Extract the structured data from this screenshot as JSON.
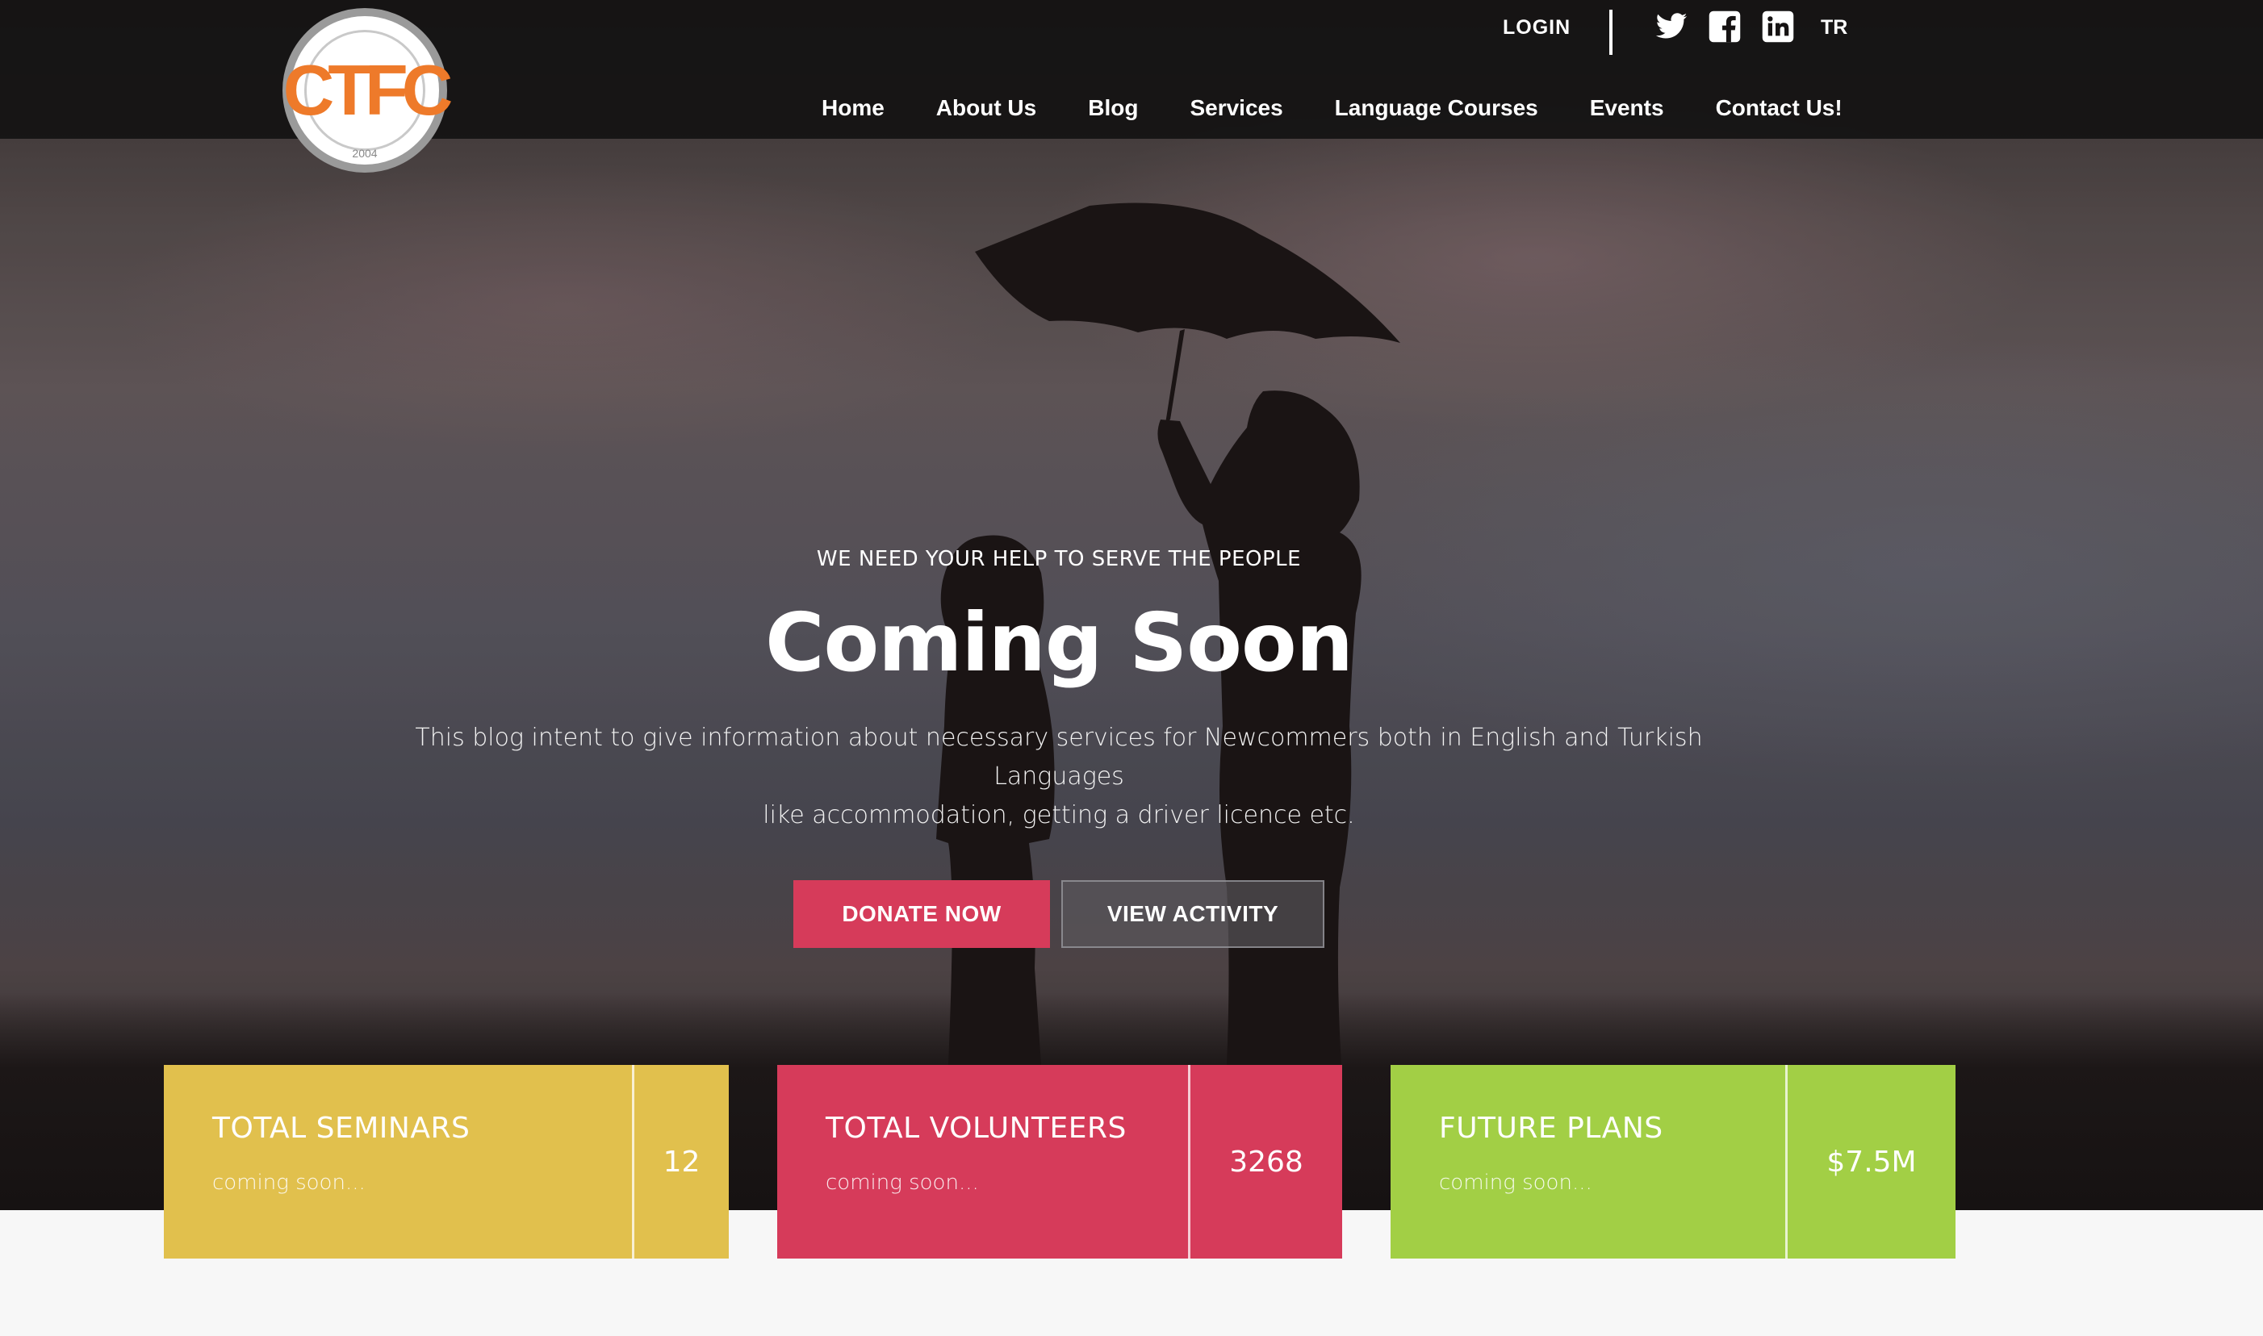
{
  "site": {
    "logo_alt": "Canadian Turkish Friendship Community",
    "logo_mark": "CTFC",
    "logo_year": "2004"
  },
  "topbar": {
    "login": "LOGIN",
    "lang": "TR",
    "social": [
      {
        "icon": "twitter-icon"
      },
      {
        "icon": "facebook-icon"
      },
      {
        "icon": "linkedin-icon"
      }
    ]
  },
  "nav": {
    "items": [
      {
        "label": "Home"
      },
      {
        "label": "About Us"
      },
      {
        "label": "Blog"
      },
      {
        "label": "Services"
      },
      {
        "label": "Language Courses"
      },
      {
        "label": "Events"
      },
      {
        "label": "Contact Us!"
      }
    ]
  },
  "hero": {
    "eyebrow": "WE NEED YOUR HELP TO SERVE THE PEOPLE",
    "headline": "Coming Soon",
    "description_line1": "This blog intent to give information about necessary services for Newcommers both in English and Turkish Languages",
    "description_line2": "like accommodation, getting a driver licence etc.",
    "donate_label": "DONATE NOW",
    "view_label": "VIEW ACTIVITY"
  },
  "stats": [
    {
      "title": "TOTAL SEMINARS",
      "sub": "coming soon...",
      "value": "12",
      "color": "#e1c04d"
    },
    {
      "title": "TOTAL VOLUNTEERS",
      "sub": "coming soon...",
      "value": "3268",
      "color": "#d63b5a"
    },
    {
      "title": "FUTURE PLANS",
      "sub": "coming soon...",
      "value": "$7.5M",
      "color": "#a2cf45"
    }
  ],
  "colors": {
    "accent_red": "#d63b5a",
    "accent_yellow": "#e1c04d",
    "accent_green": "#a2cf45",
    "logo_orange": "#ee7a2a"
  }
}
